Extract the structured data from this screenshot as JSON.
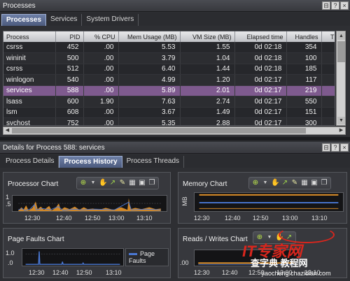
{
  "processes_panel": {
    "title": "Processes",
    "tabs": [
      {
        "label": "Processes",
        "active": true
      },
      {
        "label": "Services",
        "active": false
      },
      {
        "label": "System Drivers",
        "active": false
      }
    ],
    "columns": [
      "Process",
      "PID",
      "% CPU",
      "Mem Usage (MB)",
      "VM Size (MB)",
      "Elapsed time",
      "Handles",
      "Thre"
    ],
    "rows": [
      [
        "csrss",
        "452",
        ".00",
        "5.53",
        "1.55",
        "0d 02:18",
        "354"
      ],
      [
        "wininit",
        "500",
        ".00",
        "3.79",
        "1.04",
        "0d 02:18",
        "100"
      ],
      [
        "csrss",
        "512",
        ".00",
        "6.40",
        "1.44",
        "0d 02:18",
        "185"
      ],
      [
        "winlogon",
        "540",
        ".00",
        "4.99",
        "1.20",
        "0d 02:17",
        "117"
      ],
      [
        "services",
        "588",
        ".00",
        "5.89",
        "2.01",
        "0d 02:17",
        "219"
      ],
      [
        "lsass",
        "600",
        "1.90",
        "7.63",
        "2.74",
        "0d 02:17",
        "550"
      ],
      [
        "lsm",
        "608",
        ".00",
        "3.67",
        "1.49",
        "0d 02:17",
        "151"
      ],
      [
        "svchost",
        "752",
        ".00",
        "5.35",
        "2.88",
        "0d 02:17",
        "300"
      ]
    ],
    "selected_row": 4
  },
  "details_panel": {
    "title": "Details for Process 588: services",
    "tabs": [
      {
        "label": "Process Details",
        "active": false
      },
      {
        "label": "Process History",
        "active": true
      },
      {
        "label": "Process Threads",
        "active": false
      }
    ]
  },
  "title_buttons": [
    "⊟",
    "?",
    "×"
  ],
  "charts": {
    "processor": {
      "title": "Processor Chart",
      "y_ticks": [
        "1",
        ".5"
      ],
      "x_ticks": [
        "12:30",
        "12:40",
        "12:50",
        "13:00",
        "13:10"
      ]
    },
    "memory": {
      "title": "Memory Chart",
      "ylabel": "MB",
      "x_ticks": [
        "12:30",
        "12:40",
        "12:50",
        "13:00",
        "13:10"
      ]
    },
    "page_faults": {
      "title": "Page Faults Chart",
      "y_ticks": [
        "1.0",
        ".0"
      ],
      "x_ticks": [
        "12:30",
        "12:40",
        "12:50",
        "13:10"
      ],
      "legend": "Page Faults"
    },
    "reads_writes": {
      "title": "Reads /  Writes Chart",
      "y_ticks": [
        ".00"
      ],
      "x_ticks": [
        "12:30",
        "12:40",
        "12:50",
        "13:00",
        "13:10"
      ]
    }
  },
  "watermark": {
    "brand": "IT专家网",
    "site": "查字典 教程网",
    "url": "jiaocheng.chazidian.com"
  },
  "colors": {
    "selected_row": "#7e5a8e",
    "active_tab": "#5a6a90",
    "series_blue": "#4a78d4",
    "series_orange": "#e8962a",
    "watermark_red": "#d8261d"
  }
}
